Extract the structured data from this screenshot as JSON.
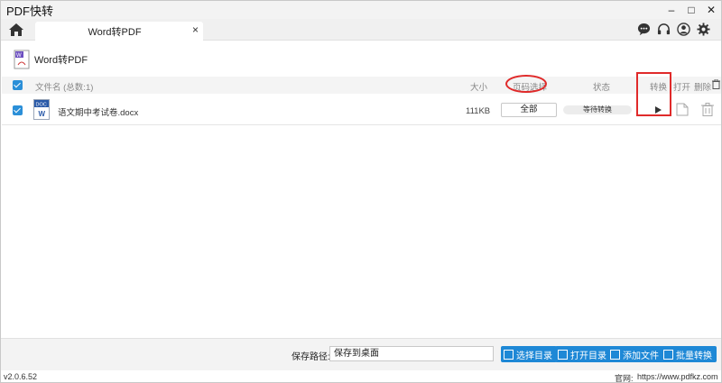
{
  "window": {
    "title": "PDF快转",
    "minimize": "–",
    "maximize": "□",
    "close": "✕"
  },
  "tabbar": {
    "tab": {
      "label": "Word转PDF",
      "close": "×"
    },
    "icons": [
      "chat-icon",
      "headset-icon",
      "user-icon",
      "gear-icon"
    ]
  },
  "section": {
    "title": "Word转PDF"
  },
  "table": {
    "headers": {
      "filename": "文件名 (总数:1)",
      "size": "大小",
      "page_select": "页码选择",
      "status": "状态",
      "convert": "转换",
      "open": "打开",
      "delete": "删除"
    },
    "rows": [
      {
        "doc_badge": "DOC",
        "doc_letter": "W",
        "filename": "语文期中考试卷.docx",
        "size": "111KB",
        "page_select": "全部",
        "status": "等待转换"
      }
    ]
  },
  "bottom": {
    "save_label": "保存路径:",
    "save_value": "保存到桌面",
    "buttons": {
      "choose_dir": "选择目录",
      "open_dir": "打开目录",
      "add_file": "添加文件",
      "batch_convert": "批量转换"
    }
  },
  "statusbar": {
    "version": "v2.0.6.52",
    "site_label": "官网:",
    "site": "https://www.pdfkz.com"
  },
  "colors": {
    "accent": "#1e88d6",
    "annotation": "#e02a2a",
    "checkbox": "#2b8fd8"
  }
}
